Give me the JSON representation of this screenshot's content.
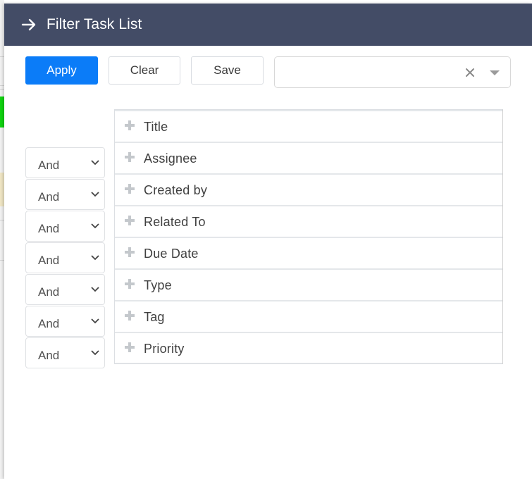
{
  "panel": {
    "title": "Filter Task List",
    "back_icon": "arrow-right-icon",
    "colors": {
      "header_bg": "#434c66",
      "primary": "#0b7cf8"
    }
  },
  "toolbar": {
    "apply_label": "Apply",
    "clear_label": "Clear",
    "save_label": "Save",
    "saved_filter_select": {
      "value": "",
      "clear_icon": "close-icon",
      "dropdown_icon": "caret-down-icon"
    }
  },
  "operators": [
    {
      "label": "And"
    },
    {
      "label": "And"
    },
    {
      "label": "And"
    },
    {
      "label": "And"
    },
    {
      "label": "And"
    },
    {
      "label": "And"
    },
    {
      "label": "And"
    }
  ],
  "fields": [
    {
      "label": "Title"
    },
    {
      "label": "Assignee"
    },
    {
      "label": "Created by"
    },
    {
      "label": "Related To"
    },
    {
      "label": "Due Date"
    },
    {
      "label": "Type"
    },
    {
      "label": "Tag"
    },
    {
      "label": "Priority"
    }
  ]
}
